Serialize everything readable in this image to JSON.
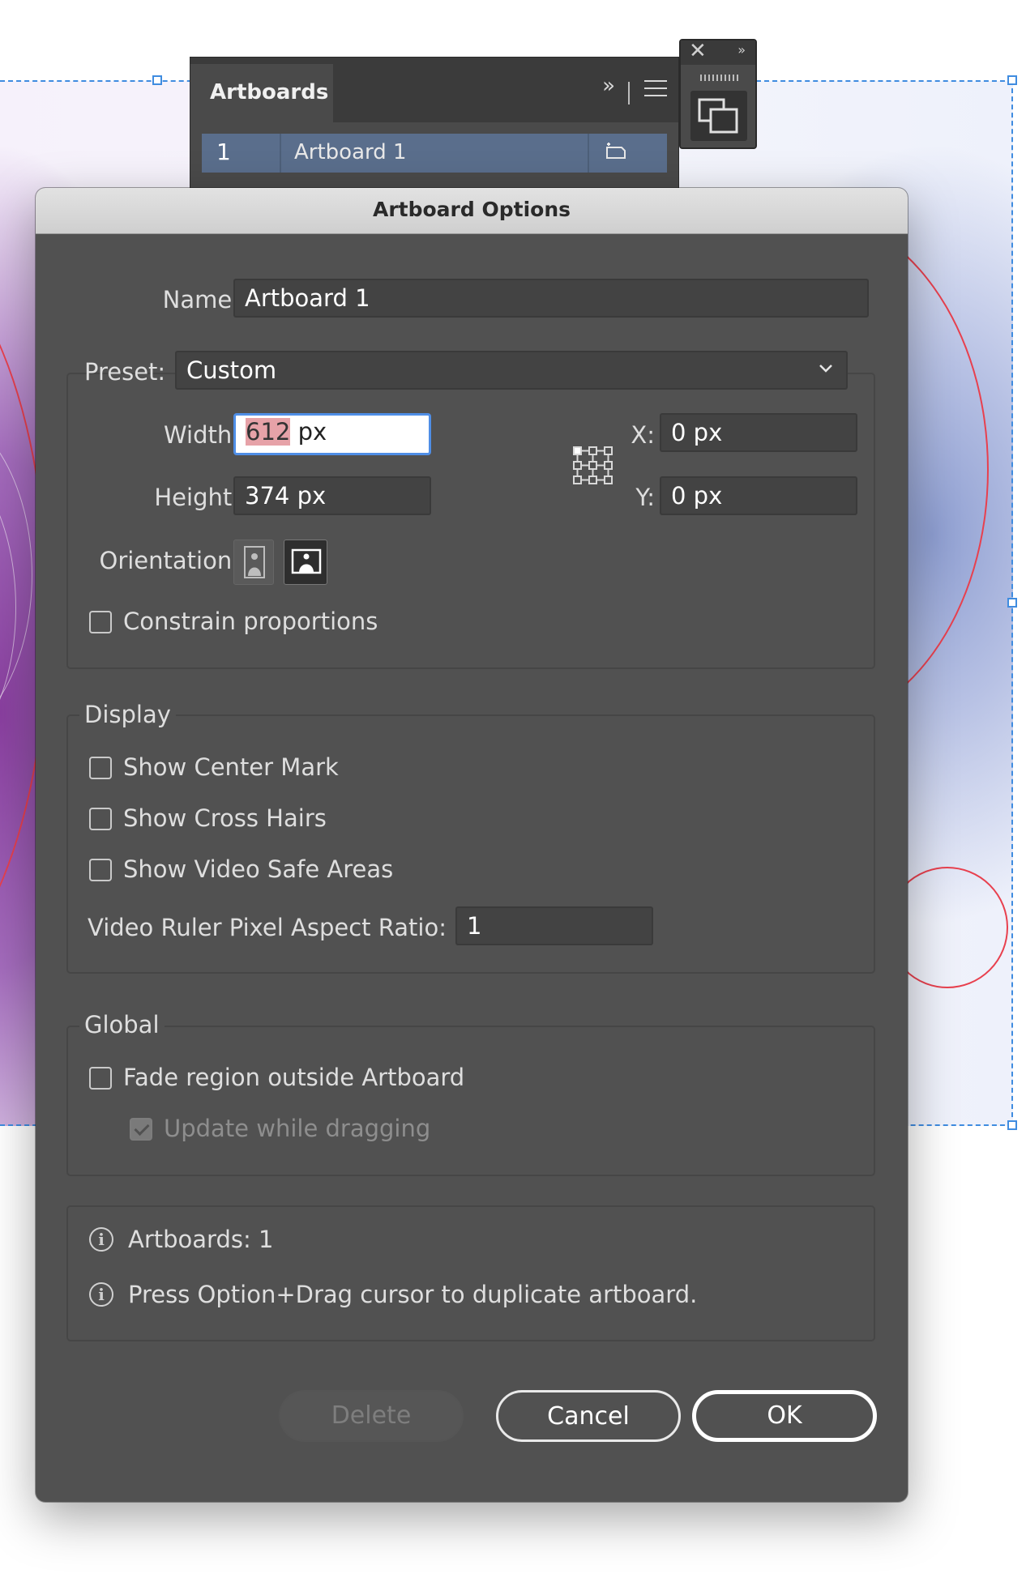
{
  "artboards_panel": {
    "tab_label": "Artboards",
    "expand_glyph": "»",
    "rows": [
      {
        "number": "1",
        "name": "Artboard 1"
      }
    ]
  },
  "mini_panel": {
    "close_glyph": "✕",
    "expand_glyph": "»"
  },
  "dialog": {
    "title": "Artboard Options",
    "name_label": "Name:",
    "name_value": "Artboard 1",
    "preset_label": "Preset:",
    "preset_value": "Custom",
    "width_label": "Width:",
    "width_number": "612",
    "width_unit": " px",
    "height_label": "Height:",
    "height_value": "374 px",
    "x_label": "X:",
    "x_value": "0 px",
    "y_label": "Y:",
    "y_value": "0 px",
    "orientation_label": "Orientation:",
    "orientation_selected": "landscape",
    "constrain_label": "Constrain proportions",
    "constrain_checked": false,
    "display": {
      "legend": "Display",
      "show_center_mark": "Show Center Mark",
      "show_cross_hairs": "Show Cross Hairs",
      "show_video_safe_areas": "Show Video Safe Areas",
      "ratio_label": "Video Ruler Pixel Aspect Ratio:",
      "ratio_value": "1"
    },
    "global": {
      "legend": "Global",
      "fade_label": "Fade region outside Artboard",
      "fade_checked": false,
      "update_label": "Update while dragging",
      "update_checked": true,
      "update_disabled": true
    },
    "info": {
      "icon_glyph": "i",
      "artboards_count": "Artboards: 1",
      "hint": "Press Option+Drag cursor to duplicate artboard."
    },
    "buttons": {
      "delete": "Delete",
      "cancel": "Cancel",
      "ok": "OK"
    }
  },
  "colors": {
    "selection_blue": "#3f8ce0",
    "guide_red": "#e8404e",
    "dialog_bg": "#515151",
    "focus_blue": "#4f8ee6"
  }
}
